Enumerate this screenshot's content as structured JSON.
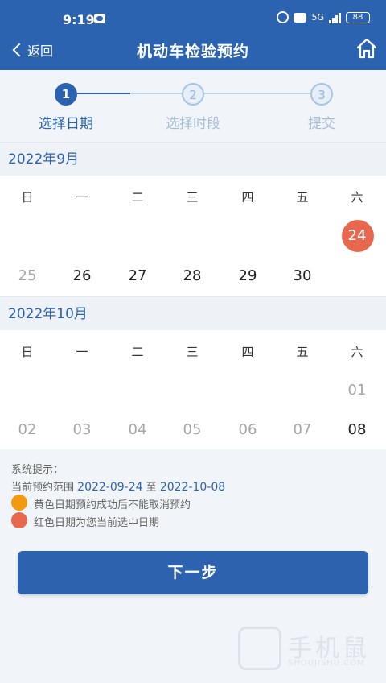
{
  "status": {
    "time": "9:19",
    "network": "5G",
    "battery": "88"
  },
  "header": {
    "back_label": "返回",
    "title": "机动车检验预约"
  },
  "steps": [
    {
      "num": "1",
      "label": "选择日期"
    },
    {
      "num": "2",
      "label": "选择时段"
    },
    {
      "num": "3",
      "label": "提交"
    }
  ],
  "weekdays": [
    "日",
    "一",
    "二",
    "三",
    "四",
    "五",
    "六"
  ],
  "months": [
    {
      "title": "2022年9月",
      "days": [
        {
          "label": "24",
          "state": "selected"
        },
        {
          "label": "25",
          "state": "disabled"
        },
        {
          "label": "26",
          "state": "enabled"
        },
        {
          "label": "27",
          "state": "enabled"
        },
        {
          "label": "28",
          "state": "enabled"
        },
        {
          "label": "29",
          "state": "enabled"
        },
        {
          "label": "30",
          "state": "enabled"
        }
      ]
    },
    {
      "title": "2022年10月",
      "days": [
        {
          "label": "01",
          "state": "disabled"
        },
        {
          "label": "02",
          "state": "disabled"
        },
        {
          "label": "03",
          "state": "disabled"
        },
        {
          "label": "04",
          "state": "disabled"
        },
        {
          "label": "05",
          "state": "disabled"
        },
        {
          "label": "06",
          "state": "disabled"
        },
        {
          "label": "07",
          "state": "disabled"
        },
        {
          "label": "08",
          "state": "enabled"
        }
      ]
    }
  ],
  "notes": {
    "heading": "系统提示：",
    "range_prefix": "当前预约范围",
    "range_start": "2022-09-24",
    "range_sep": "至",
    "range_end": "2022-10-08",
    "legend_yellow": "黄色日期预约成功后不能取消预约",
    "legend_red": "红色日期为您当前选中日期"
  },
  "next_button_label": "下一步",
  "watermark": {
    "text": "手机鼠",
    "sub": "SHOUJISHU.COM"
  },
  "colors": {
    "primary": "#2c63b1",
    "selected": "#e8674f",
    "yellow": "#f39a12"
  }
}
